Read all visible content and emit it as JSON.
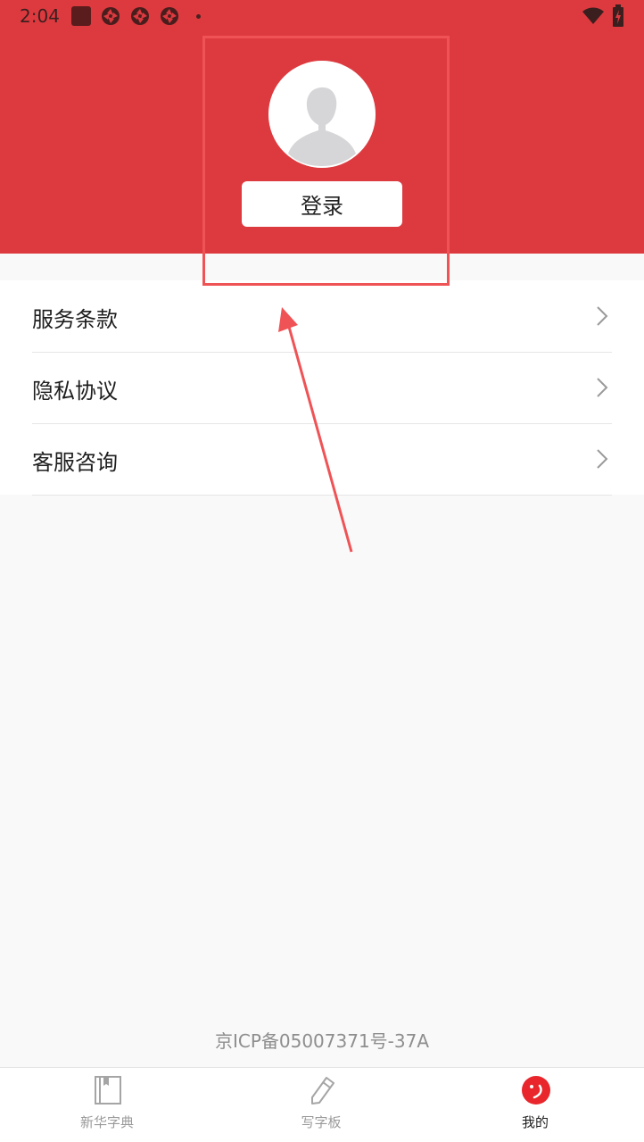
{
  "status_bar": {
    "time": "2:04"
  },
  "profile": {
    "login_label": "登录"
  },
  "menu": {
    "items": [
      {
        "label": "服务条款"
      },
      {
        "label": "隐私协议"
      },
      {
        "label": "客服咨询"
      }
    ]
  },
  "footer": {
    "icp": "京ICP备05007371号-37A"
  },
  "tabbar": {
    "tabs": [
      {
        "label": "新华字典",
        "icon": "book-icon"
      },
      {
        "label": "写字板",
        "icon": "pencil-icon"
      },
      {
        "label": "我的",
        "icon": "smile-icon",
        "active": true
      }
    ]
  },
  "colors": {
    "header_red": "#dd3a3f",
    "annotation_red": "#ef5356",
    "active_tab_red": "#e8262b"
  }
}
